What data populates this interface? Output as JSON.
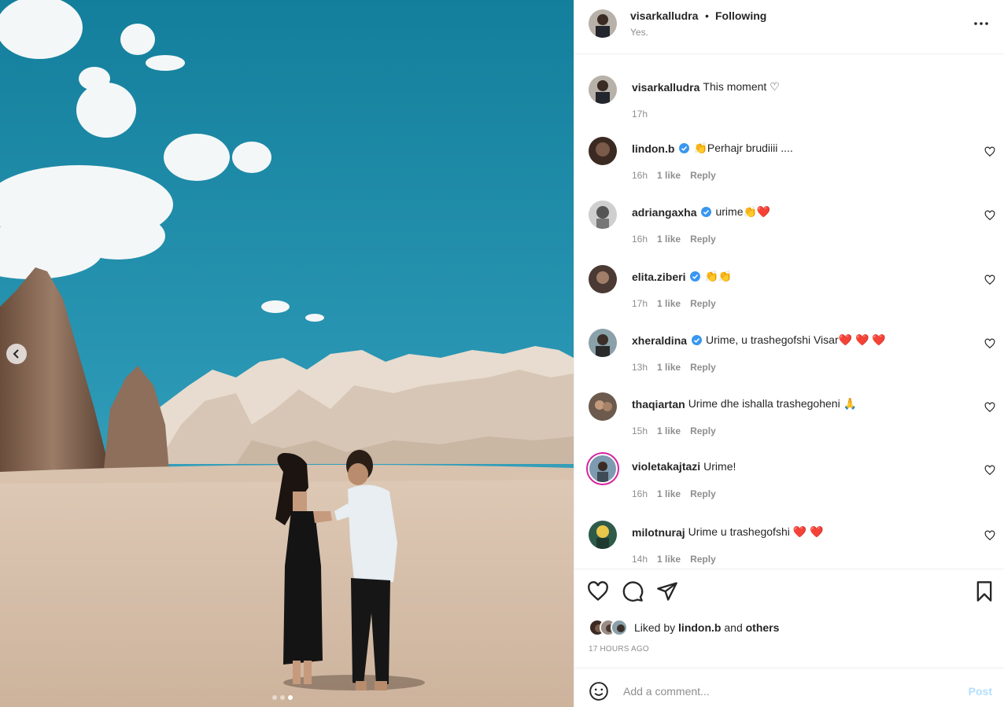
{
  "header": {
    "username": "visarkalludra",
    "separator": "•",
    "follow_label": "Following",
    "subtitle": "Yes."
  },
  "caption": {
    "username": "visarkalludra",
    "text": "This moment ♡",
    "time": "17h"
  },
  "comments": [
    {
      "username": "lindon.b",
      "verified": true,
      "text": "👏Perhajr brudiiii ....",
      "time": "16h",
      "likes": "1 like",
      "reply": "Reply"
    },
    {
      "username": "adriangaxha",
      "verified": true,
      "text": "urime👏❤️",
      "time": "16h",
      "likes": "1 like",
      "reply": "Reply"
    },
    {
      "username": "elita.ziberi",
      "verified": true,
      "text": "👏👏",
      "time": "17h",
      "likes": "1 like",
      "reply": "Reply"
    },
    {
      "username": "xheraldina",
      "verified": true,
      "text": "Urime, u trashegofshi Visar❤️ ❤️ ❤️",
      "time": "13h",
      "likes": "1 like",
      "reply": "Reply"
    },
    {
      "username": "thaqiartan",
      "verified": false,
      "text": "Urime dhe ishalla trashegoheni 🙏",
      "time": "15h",
      "likes": "1 like",
      "reply": "Reply"
    },
    {
      "username": "violetakajtazi",
      "verified": false,
      "text": "Urime!",
      "time": "16h",
      "likes": "1 like",
      "reply": "Reply"
    },
    {
      "username": "milotnuraj",
      "verified": false,
      "text": "Urime u trashegofshi ❤️ ❤️",
      "time": "14h",
      "likes": "1 like",
      "reply": "Reply"
    }
  ],
  "likes": {
    "prefix": "Liked by",
    "user": "lindon.b",
    "and": "and",
    "others": "others"
  },
  "timestamp": "17 HOURS AGO",
  "add_comment": {
    "placeholder": "Add a comment...",
    "post_label": "Post"
  },
  "colors": {
    "verified": "#3897f0",
    "post_disabled": "#b2dffc",
    "sky": "#1b8aa6"
  },
  "icons": [
    "chevron-left-icon",
    "more-icon",
    "heart-icon",
    "comment-icon",
    "share-icon",
    "bookmark-icon",
    "emoji-icon",
    "verified-icon"
  ]
}
